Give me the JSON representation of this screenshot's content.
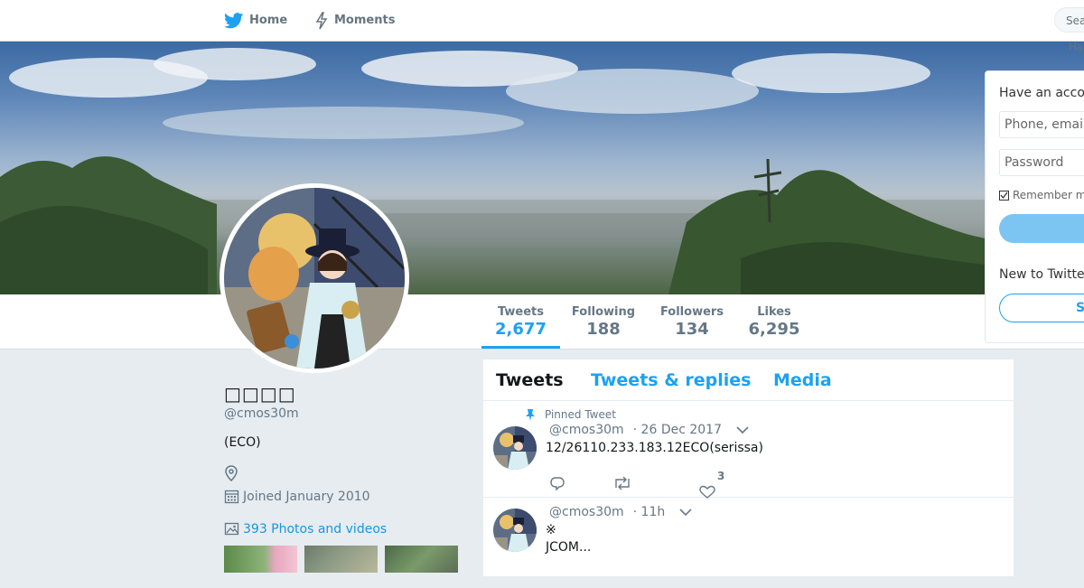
{
  "nav": {
    "home_label": "Home",
    "moments_label": "Moments",
    "search_placeholder": "Sea",
    "truncated_text": "Ha"
  },
  "profile": {
    "name": "□□□□",
    "handle": "@cmos30m",
    "bio": "(ECO)",
    "joined": "Joined January 2010",
    "photos_link": "393 Photos and videos"
  },
  "stats": [
    {
      "label": "Tweets",
      "value": "2,677"
    },
    {
      "label": "Following",
      "value": "188"
    },
    {
      "label": "Followers",
      "value": "134"
    },
    {
      "label": "Likes",
      "value": "6,295"
    }
  ],
  "timeline": {
    "tabs": [
      "Tweets",
      "Tweets & replies",
      "Media"
    ],
    "pinned_label": "Pinned Tweet",
    "tweets": [
      {
        "handle": "@cmos30m",
        "time": "· 26 Dec 2017",
        "line1": "12/26110.233.183.12ECO(serissa)",
        "line2": "",
        "like_count": "3"
      },
      {
        "handle": "@cmos30m",
        "time": "· 11h",
        "line1": "※",
        "line2": "JCOM..."
      }
    ]
  },
  "login": {
    "title": "Have an acco",
    "phone_placeholder": "Phone, email",
    "password_placeholder": "Password",
    "remember": "Remember m",
    "new_to": "New to Twitte",
    "signup_label": "S"
  },
  "colors": {
    "accent": "#1da1f2",
    "background": "#e6ecf0"
  }
}
